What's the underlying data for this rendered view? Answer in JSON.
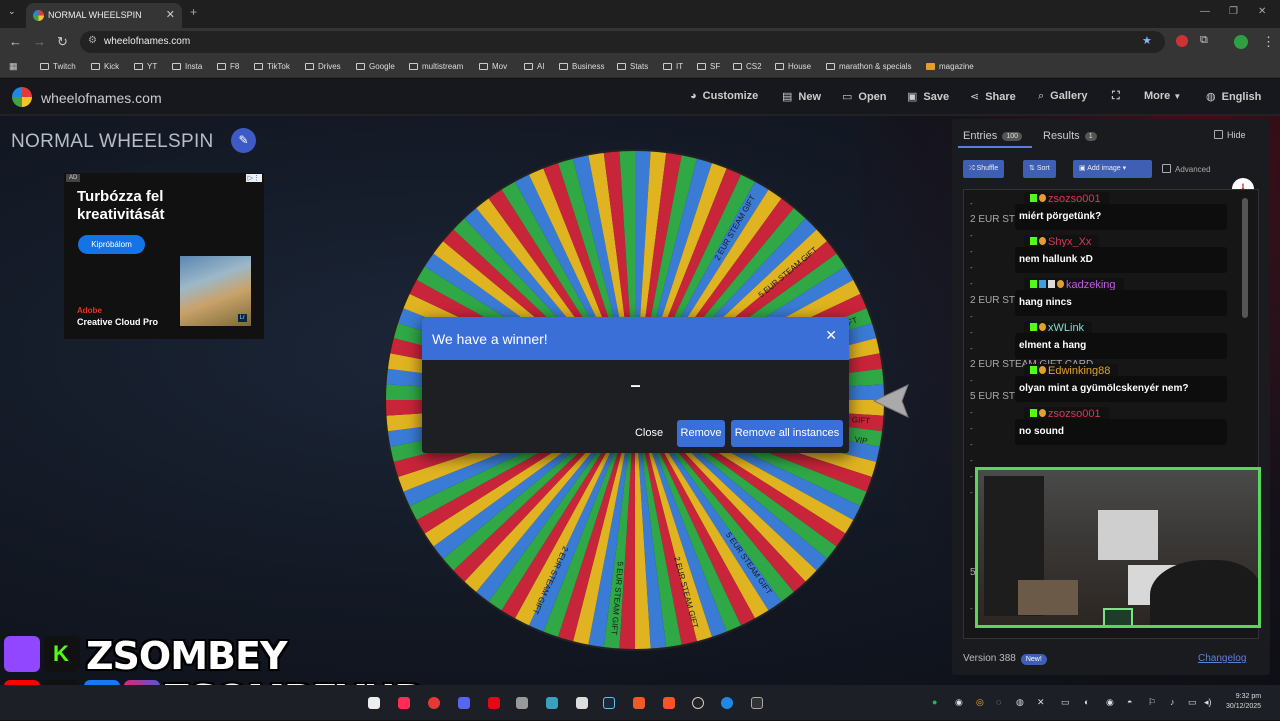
{
  "browser": {
    "tab_title": "NORMAL WHEELSPIN",
    "url": "wheelofnames.com",
    "bookmarks": [
      "Twitch",
      "Kick",
      "YT",
      "Insta",
      "F8",
      "TikTok",
      "Drives",
      "Google",
      "multistream",
      "Mov",
      "AI",
      "Business",
      "Stats",
      "IT",
      "SF",
      "CS2",
      "House",
      "marathon & specials",
      "magazine"
    ]
  },
  "app": {
    "logo": "wheelofnames.com",
    "menu": [
      "Customize",
      "New",
      "Open",
      "Save",
      "Share",
      "Gallery",
      "More",
      "English"
    ],
    "title": "NORMAL WHEELSPIN"
  },
  "ad": {
    "tag": "AD",
    "headline": "Turbózza fel kreativitását",
    "cta": "Kipróbálom",
    "brand_line1": "Adobe",
    "brand_line2": "Creative Cloud Pro",
    "badge": "Lr"
  },
  "wheel": {
    "segment_colors": [
      "#3a7bd5",
      "#e0b320",
      "#c8243a",
      "#2fa845"
    ],
    "segment_count": 100,
    "labels": [
      "2 EUR STEAM GIFT",
      "5 EUR STEAM GIFT",
      "2 EUR STEAM GIFT",
      "2 EUR STEAM GIFT",
      "5 EUR STEAM GIFT",
      "2 EUR STEAM GIFT",
      "5 EUR STEAM GIFT",
      "2 EUR STEAM GIFT",
      "VIP"
    ]
  },
  "dialog": {
    "title": "We have a winner!",
    "winner": "–",
    "close_label": "Close",
    "remove_label": "Remove",
    "remove_all_label": "Remove all instances"
  },
  "panel": {
    "entries_tab": "Entries",
    "entries_count": "100",
    "results_tab": "Results",
    "results_count": "1",
    "hide_label": "Hide",
    "shuffle_label": "Shuffle",
    "sort_label": "Sort",
    "add_image_label": "Add image",
    "advanced_label": "Advanced",
    "entry_texts": [
      "2 EUR STEAM GIFT CARD",
      "2 EUR STEAM GIFT CARD",
      "2 EUR STEAM GIFT CARD",
      "5 EUR STEAM GIFT CARD",
      "5"
    ],
    "version": "Version 388",
    "new_badge": "New!",
    "changelog": "Changelog"
  },
  "chat": [
    {
      "user": "zsozso001",
      "color": "#e0335a",
      "msg": "miért pörgetünk?"
    },
    {
      "user": "Shyx_Xx",
      "color": "#e0335a",
      "msg": "nem hallunk xD"
    },
    {
      "user": "kadzeking",
      "color": "#c35ae0",
      "msg": "hang nincs"
    },
    {
      "user": "xWLink",
      "color": "#7fe0d0",
      "msg": "elment a hang"
    },
    {
      "user": "Edwinking88",
      "color": "#e0a030",
      "msg": "olyan mint a gyümölcskenyér nem?"
    },
    {
      "user": "zsozso001",
      "color": "#e0335a",
      "msg": "no sound"
    }
  ],
  "overlay": {
    "handle1": "ZSOMBEY",
    "handle2": "ZSOMBEYHD"
  },
  "taskbar": {
    "time": "9:32 pm",
    "date": "30/12/2025"
  }
}
